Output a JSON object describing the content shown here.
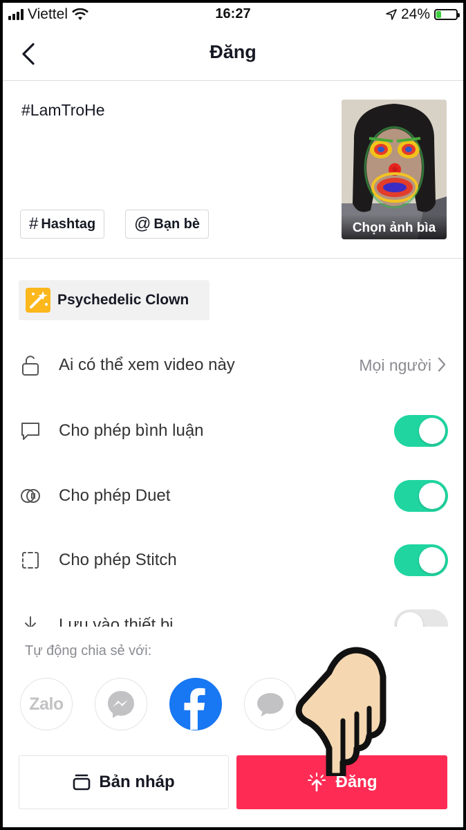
{
  "status_bar": {
    "carrier": "Viettel",
    "time": "16:27",
    "battery": "24%",
    "battery_level": 0.24
  },
  "header": {
    "title": "Đăng"
  },
  "post": {
    "caption": "#LamTroHe",
    "hashtag_button": "Hashtag",
    "friends_button": "Bạn bè",
    "cover_label": "Chọn ảnh bìa"
  },
  "effect": {
    "name": "Psychedelic Clown"
  },
  "settings": {
    "privacy_label": "Ai có thể xem video này",
    "privacy_value": "Mọi người",
    "comments_label": "Cho phép bình luận",
    "comments_on": true,
    "duet_label": "Cho phép Duet",
    "duet_on": true,
    "stitch_label": "Cho phép Stitch",
    "stitch_on": true,
    "save_label": "Lưu vào thiết bị",
    "save_on": false
  },
  "share": {
    "label": "Tự động chia sẻ với:",
    "zalo": "Zalo"
  },
  "actions": {
    "draft_label": "Bản nháp",
    "post_label": "Đăng"
  },
  "colors": {
    "accent": "#fe2c55",
    "toggle_on": "#20d5a0",
    "facebook": "#1877f2"
  }
}
